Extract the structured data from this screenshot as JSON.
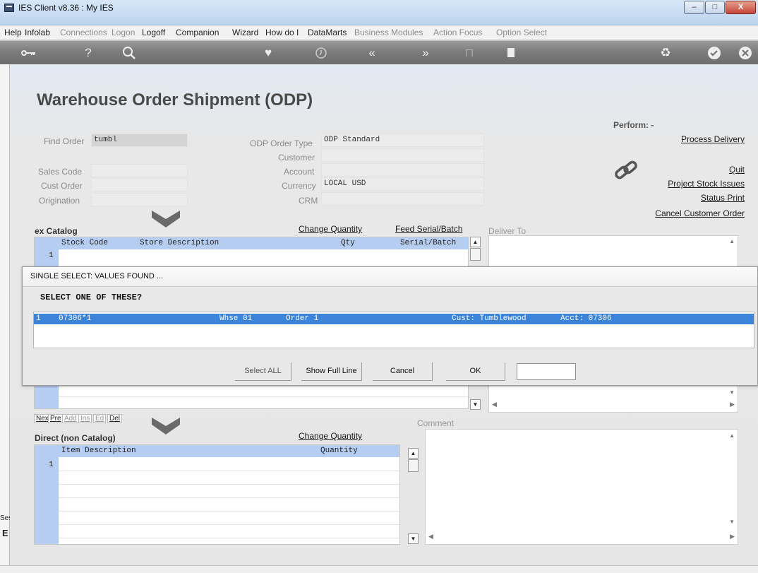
{
  "window": {
    "title": "IES Client v8.36 : My IES",
    "minimize": "–",
    "maximize": "□",
    "close": "X"
  },
  "menu": [
    {
      "label": "Help",
      "enabled": true
    },
    {
      "label": "Infolab",
      "enabled": true
    },
    {
      "label": "Connections",
      "enabled": false
    },
    {
      "label": "Logon",
      "enabled": false
    },
    {
      "label": "Logoff",
      "enabled": true
    },
    {
      "label": "Companion",
      "enabled": true
    },
    {
      "label": "Wizard",
      "enabled": true
    },
    {
      "label": "How do I",
      "enabled": true
    },
    {
      "label": "DataMarts",
      "enabled": true
    },
    {
      "label": "Business Modules",
      "enabled": false
    },
    {
      "label": "Action Focus",
      "enabled": false
    },
    {
      "label": "Option Select",
      "enabled": false
    }
  ],
  "toolbar": [
    "key-icon",
    "help-icon",
    "search-icon",
    "heart-icon",
    "clock-icon",
    "rewind-icon",
    "forward-icon",
    "bookmark-icon",
    "page-icon",
    "recycle-icon",
    "check-icon",
    "close-icon"
  ],
  "page": {
    "title": "Warehouse Order Shipment (ODP)",
    "find_order_label": "Find Order",
    "find_order_value": "tumbl",
    "sales_code_label": "Sales Code",
    "cust_order_label": "Cust Order",
    "origination_label": "Origination",
    "order_type_label": "ODP Order Type",
    "order_type_value": "ODP Standard",
    "customer_label": "Customer",
    "account_label": "Account",
    "currency_label": "Currency",
    "currency_value": "LOCAL USD",
    "crm_label": "CRM"
  },
  "perform": {
    "label": "Perform: -",
    "process_delivery": "Process Delivery",
    "quit": "Quit",
    "project_stock_issues": "Project Stock Issues",
    "status_print": "Status Print",
    "cancel_customer_order": "Cancel Customer Order"
  },
  "catalog": {
    "title": "ex Catalog",
    "change_quantity": "Change Quantity",
    "feed_serial": "Feed Serial/Batch",
    "columns": {
      "stock_code": "Stock Code",
      "store_description": "Store Description",
      "qty": "Qty",
      "serial": "Serial/Batch"
    },
    "row_number": "1"
  },
  "deliver_to_label": "Deliver To",
  "row_tabs": [
    "Nex",
    "Pre",
    "Add",
    "Ins",
    "Ed",
    "Del"
  ],
  "direct": {
    "title": "Direct (non Catalog)",
    "change_quantity": "Change Quantity",
    "columns": {
      "item_description": "Item Description",
      "quantity": "Quantity"
    },
    "row_number": "1"
  },
  "comment_label": "Comment",
  "side_fragment": {
    "ses": "Ses",
    "glyph": "E"
  },
  "dialog": {
    "title": "SINGLE SELECT: VALUES FOUND ...",
    "question": "SELECT ONE OF THESE?",
    "result": {
      "index": "1",
      "code": "07306*1",
      "warehouse": "Whse 01",
      "order": "Order 1",
      "customer": "Cust: Tumblewood",
      "account": "Acct: 07306"
    },
    "buttons": {
      "select_all": "Select ALL",
      "show_full_line": "Show Full Line",
      "cancel": "Cancel",
      "ok": "OK"
    },
    "input_value": ""
  }
}
